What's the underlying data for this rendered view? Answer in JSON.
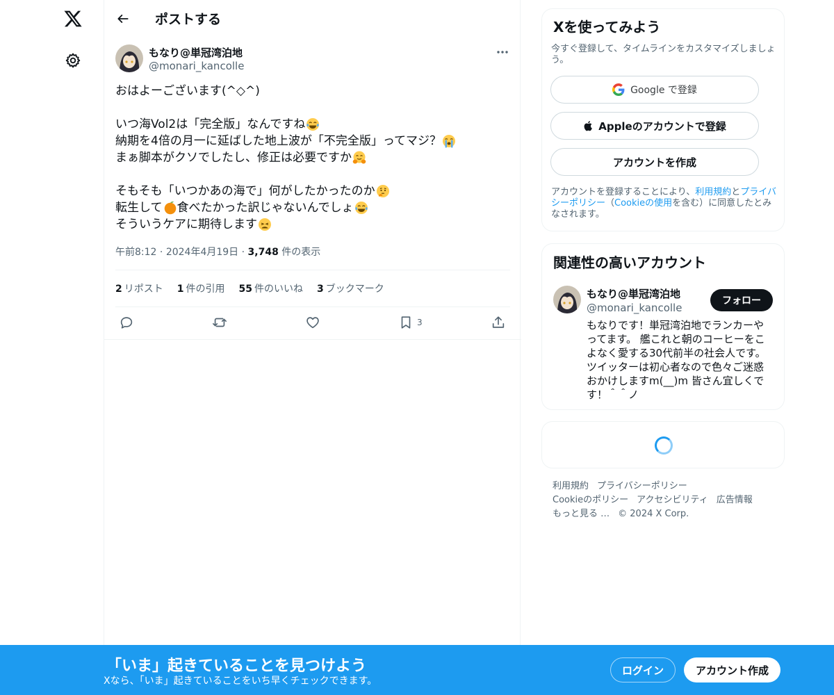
{
  "header": {
    "title": "ポストする"
  },
  "post": {
    "author_name": "もなり@単冠湾泊地",
    "author_handle": "@monari_kancolle",
    "lines": [
      "おはよーございます(^◇^)",
      "",
      "いつ海Vol2は「完全版」なんですね",
      "納期を4倍の月一に延ばした地上波が「不完全版」ってマジ？",
      "まぁ脚本がクソでしたし、修正は必要ですか",
      "",
      "そもそも「いつかあの海で」何がしたかったのか",
      "転生して",
      "食べたかった訳じゃないんでしょ",
      "そういうケアに期待します"
    ],
    "emoji": {
      "laugh_cry": "face-with-tears-of-joy",
      "loud_cry": "loudly-crying-face",
      "hug": "hugging-face",
      "think": "thinking-face",
      "orange": "tangerine",
      "weary": "weary-face"
    },
    "time": "午前8:12",
    "date": "2024年4月19日",
    "views_count": "3,748",
    "views_label": "件の表示",
    "stats": {
      "reposts_count": "2",
      "reposts_label": "リポスト",
      "quotes_count": "1",
      "quotes_label": "件の引用",
      "likes_count": "55",
      "likes_label": "件のいいね",
      "bookmarks_count": "3",
      "bookmarks_label": "ブックマーク"
    },
    "actions": {
      "bookmark_count": "3"
    }
  },
  "signup_card": {
    "title": "Xを使ってみよう",
    "subtitle": "今すぐ登録して、タイムラインをカスタマイズしましょう。",
    "google_label": "Google で登録",
    "apple_label": "Appleのアカウントで登録",
    "create_label": "アカウントを作成",
    "terms_prefix": "アカウントを登録することにより、",
    "terms_link": "利用規約",
    "terms_and": "と",
    "privacy_link": "プライバシーポリシー",
    "paren_open": "（",
    "cookie_link": "Cookieの使用",
    "terms_suffix": "を含む）に同意したとみなされます。"
  },
  "relevant_card": {
    "title": "関連性の高いアカウント",
    "name": "もなり@単冠湾泊地",
    "handle": "@monari_kancolle",
    "follow_label": "フォロー",
    "bio": "もなりです！単冠湾泊地でランカーやってます。 艦これと朝のコーヒーをこよなく愛する30代前半の社会人です。ツイッターは初心者なので色々ご迷惑おかけしますm(__)m 皆さん宜しくです！＾＾ノ"
  },
  "footer": {
    "terms": "利用規約",
    "privacy": "プライバシーポリシー",
    "cookie": "Cookieのポリシー",
    "accessibility": "アクセシビリティ",
    "ads": "広告情報",
    "more": "もっと見る …",
    "copyright": "© 2024 X Corp."
  },
  "bottom_bar": {
    "title": "「いま」起きていることを見つけよう",
    "subtitle": "Xなら、「いま」起きていることをいち早くチェックできます。",
    "login_label": "ログイン",
    "signup_label": "アカウント作成"
  },
  "colors": {
    "accent": "#1d9bf0",
    "text": "#0f1419",
    "muted": "#536471"
  }
}
